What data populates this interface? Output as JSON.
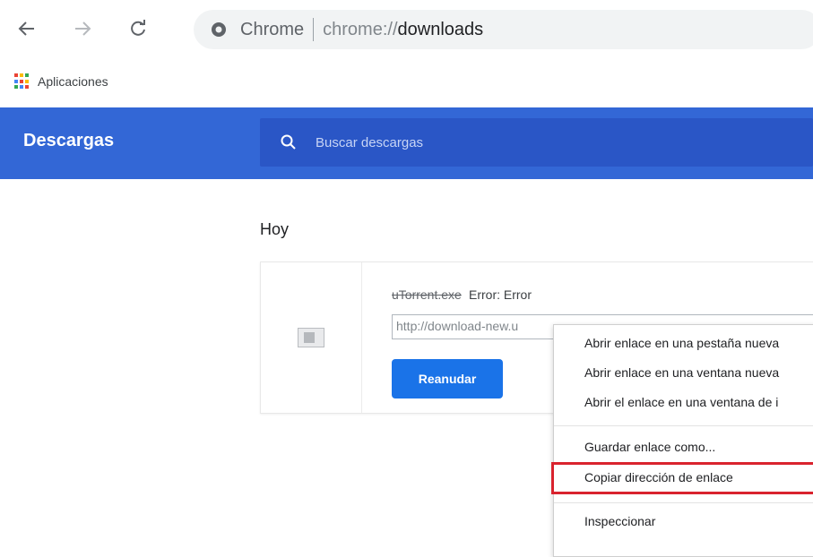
{
  "toolbar": {
    "back_icon": "arrow-left-icon",
    "forward_icon": "arrow-right-icon",
    "reload_icon": "reload-icon",
    "site_name": "Chrome",
    "url_prefix": "chrome://",
    "url_path": "downloads"
  },
  "bookmarks": {
    "apps_label": "Aplicaciones"
  },
  "header": {
    "title": "Descargas",
    "search_placeholder": "Buscar descargas"
  },
  "content": {
    "day_label": "Hoy",
    "item": {
      "file_name": "uTorrent.exe",
      "status": "Error: Error",
      "url": "http://download-new.u",
      "resume_label": "Reanudar"
    }
  },
  "context_menu": {
    "items": [
      "Abrir enlace en una pestaña nueva",
      "Abrir enlace en una ventana nueva",
      "Abrir el enlace en una ventana de i",
      "Guardar enlace como...",
      "Copiar dirección de enlace",
      "Inspeccionar"
    ],
    "highlighted_index": 4
  },
  "colors": {
    "header_bg": "#3367d6",
    "search_bg": "#2a56c6",
    "button_bg": "#1a73e8",
    "highlight_border": "#d9232e"
  }
}
